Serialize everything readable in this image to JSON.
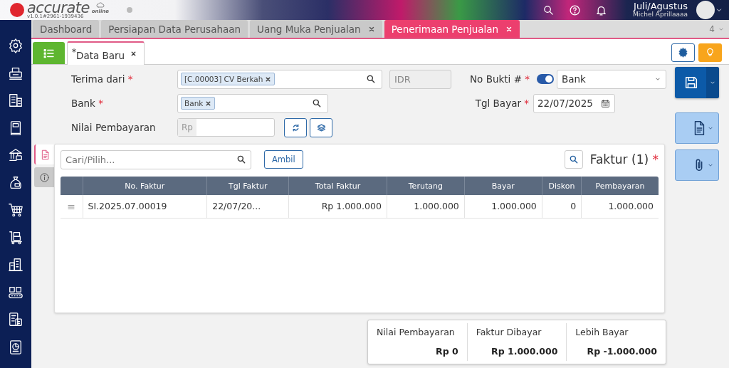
{
  "header": {
    "logo_text": "accurate",
    "logo_sub": "online",
    "version": "v1.0.1#2961-1939436",
    "period": "Juli/Agustus",
    "user": "Michel Aprillaaaa"
  },
  "tabs": [
    {
      "label": "Dashboard",
      "closable": false,
      "selected": false
    },
    {
      "label": "Persiapan Data Perusahaan",
      "closable": false,
      "selected": false
    },
    {
      "label": "Uang Muka Penjualan",
      "closable": true,
      "selected": false
    },
    {
      "label": "Penerimaan Penjualan",
      "closable": true,
      "selected": true
    }
  ],
  "tab_count": "4",
  "subtab": {
    "label": "$^{*}$Data Baru"
  },
  "form": {
    "terima_dari": {
      "label": "Terima dari",
      "required_mark": "*",
      "tag": "[C.00003] CV Berkah"
    },
    "currency": "IDR",
    "no_bukti": {
      "label": "No Bukti #",
      "required_mark": "*",
      "auto_number": true,
      "value": "Bank"
    },
    "bank": {
      "label": "Bank",
      "required_mark": "*",
      "tag": "Bank"
    },
    "tgl_bayar": {
      "label": "Tgl Bayar",
      "required_mark": "*",
      "value": "22/07/2025"
    },
    "nilai_pembayaran": {
      "label": "Nilai Pembayaran",
      "prefix": "Rp"
    }
  },
  "panel": {
    "side_tabs": [
      {
        "kind": "document",
        "selected": true
      },
      {
        "kind": "info",
        "selected": false
      }
    ],
    "search": {
      "placeholder": "Cari/Pilih..."
    },
    "ambil_button": "Ambil",
    "title": "Faktur (1)",
    "title_mark": "*",
    "table": {
      "columns": [
        "No. Faktur",
        "Tgl Faktur",
        "Total Faktur",
        "Terutang",
        "Bayar",
        "Diskon",
        "Pembayaran"
      ],
      "rows": [
        {
          "cells": [
            "SI.2025.07.00019",
            "22/07/20...",
            "Rp 1.000.000",
            "1.000.000",
            "1.000.000",
            "0",
            "1.000.000"
          ]
        }
      ]
    }
  },
  "summary": [
    {
      "label": "Nilai Pembayaran",
      "value": "Rp 0"
    },
    {
      "label": "Faktur Dibayar",
      "value": "Rp 1.000.000"
    },
    {
      "label": "Lebih Bayar",
      "value": "Rp -1.000.000"
    }
  ]
}
